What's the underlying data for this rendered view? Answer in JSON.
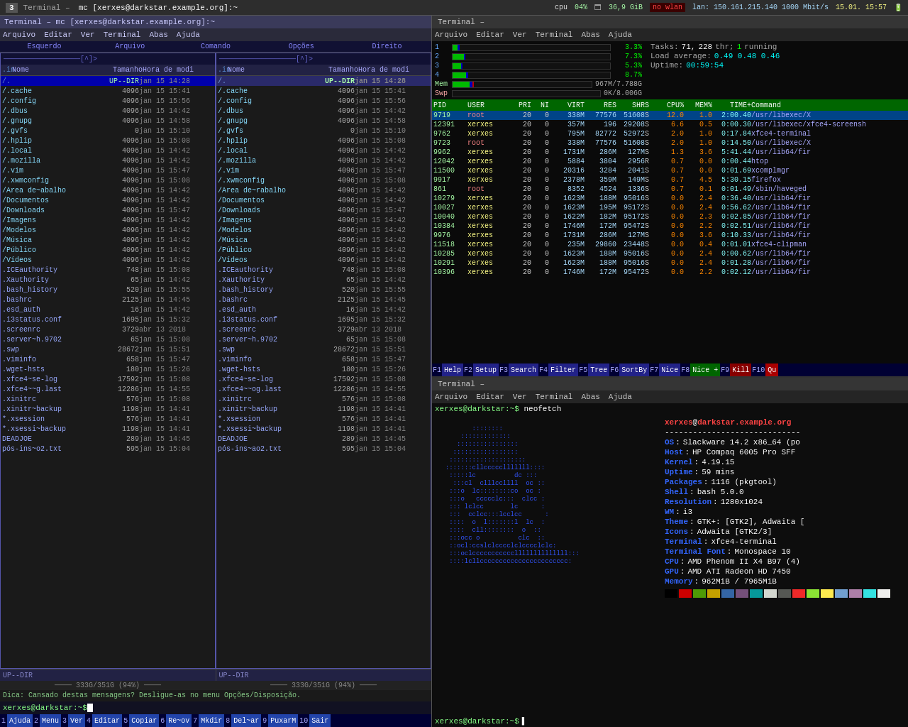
{
  "topbar": {
    "label": "Terminal –",
    "title": "mc [xerxes@darkstar.example.org]:~",
    "cpu_label": "cpu",
    "cpu_pct": "04%",
    "mem_icon": "🗖",
    "mem_val": "36,9 GiB",
    "net_warn": "no wlan",
    "net_label": "lan: 150.161.215.140  1000 Mbit/s",
    "time": "15.01. 15:57"
  },
  "left_panel": {
    "title": "Terminal – mc [xerxes@darkstar.example.org]:~",
    "menu_items": [
      "Arquivo",
      "Editar",
      "Ver",
      "Terminal",
      "Abas",
      "Ajuda"
    ],
    "panel_nav": "[^]>",
    "panel_labels": [
      "Esquerdo",
      "Arquivo",
      "Comando",
      "Opções",
      "Direito"
    ],
    "left_pane": {
      "header": "[^]>",
      "path": "~",
      "cols": [
        ".in",
        "Nome",
        "Tamanho",
        "Hora de modi"
      ],
      "selected_row": "/.",
      "selected_dir": "UP--DIR",
      "selected_date": "jan 15 14:28",
      "files": [
        {
          "name": "/.cache",
          "size": "4096",
          "date": "jan 15 15:41"
        },
        {
          "name": "/.config",
          "size": "4096",
          "date": "jan 15 15:56"
        },
        {
          "name": "/.dbus",
          "size": "4096",
          "date": "jan 15 14:42"
        },
        {
          "name": "/.gnupg",
          "size": "4096",
          "date": "jan 15 14:58"
        },
        {
          "name": "/.gvfs",
          "size": "0",
          "date": "jan 15 15:10"
        },
        {
          "name": "/.hplip",
          "size": "4096",
          "date": "jan 15 15:08"
        },
        {
          "name": "/.local",
          "size": "4096",
          "date": "jan 15 14:42"
        },
        {
          "name": "/.mozilla",
          "size": "4096",
          "date": "jan 15 14:42"
        },
        {
          "name": "/.vim",
          "size": "4096",
          "date": "jan 15 15:47"
        },
        {
          "name": "/.xwmconfig",
          "size": "4096",
          "date": "jan 15 15:08"
        },
        {
          "name": "/Área de~abalho",
          "size": "4096",
          "date": "jan 15 14:42"
        },
        {
          "name": "/Documentos",
          "size": "4096",
          "date": "jan 15 14:42"
        },
        {
          "name": "/Downloads",
          "size": "4096",
          "date": "jan 15 15:47"
        },
        {
          "name": "/Imagens",
          "size": "4096",
          "date": "jan 15 14:42"
        },
        {
          "name": "/Modelos",
          "size": "4096",
          "date": "jan 15 14:42"
        },
        {
          "name": "/Música",
          "size": "4096",
          "date": "jan 15 14:42"
        },
        {
          "name": "/Público",
          "size": "4096",
          "date": "jan 15 14:42"
        },
        {
          "name": "/Vídeos",
          "size": "4096",
          "date": "jan 15 14:42"
        },
        {
          "name": ".ICEauthority",
          "size": "748",
          "date": "jan 15 15:08"
        },
        {
          "name": ".Xauthority",
          "size": "65",
          "date": "jan 15 14:42"
        },
        {
          "name": ".bash_history",
          "size": "520",
          "date": "jan 15 15:55"
        },
        {
          "name": ".bashrc",
          "size": "2125",
          "date": "jan 15 14:45"
        },
        {
          "name": ".esd_auth",
          "size": "16",
          "date": "jan 15 14:42"
        },
        {
          "name": ".i3status.conf",
          "size": "1695",
          "date": "jan 15 15:32"
        },
        {
          "name": ".screenrc",
          "size": "3729",
          "date": "abr 13  2018"
        },
        {
          "name": ".server~h.9702",
          "size": "65",
          "date": "jan 15 15:08"
        },
        {
          "name": ".swp",
          "size": "28672",
          "date": "jan 15 15:51"
        },
        {
          "name": ".viminfo",
          "size": "658",
          "date": "jan 15 15:47"
        },
        {
          "name": ".wget-hsts",
          "size": "180",
          "date": "jan 15 15:26"
        },
        {
          "name": ".xfce4~se-log",
          "size": "17592",
          "date": "jan 15 15:08"
        },
        {
          "name": ".xfce4~~g.last",
          "size": "12286",
          "date": "jan 15 14:55"
        },
        {
          "name": ".xinitrc",
          "size": "576",
          "date": "jan 15 15:08"
        },
        {
          "name": ".xinitr~backup",
          "size": "1198",
          "date": "jan 15 14:41"
        },
        {
          "name": "*.xsession",
          "size": "576",
          "date": "jan 15 14:41"
        },
        {
          "name": "*.xsessi~backup",
          "size": "1198",
          "date": "jan 15 14:41"
        },
        {
          "name": "DEADJOE",
          "size": "289",
          "date": "jan 15 14:45"
        },
        {
          "name": "pós-ins~o2.txt",
          "size": "595",
          "date": "jan 15 15:04"
        }
      ]
    },
    "right_pane": {
      "header": "[^]>",
      "cols": [
        ".in",
        "Nome",
        "Tamanho",
        "Hora de modi"
      ],
      "selected_row": "/.",
      "selected_dir": "UP--DIR",
      "selected_date": "jan 15 14:28",
      "files": [
        {
          "name": "/.cache",
          "size": "4096",
          "date": "jan 15 15:41"
        },
        {
          "name": "/.config",
          "size": "4096",
          "date": "jan 15 15:56"
        },
        {
          "name": "/.dbus",
          "size": "4096",
          "date": "jan 15 14:42"
        },
        {
          "name": "/.gnupg",
          "size": "4096",
          "date": "jan 15 14:58"
        },
        {
          "name": "/.gvfs",
          "size": "0",
          "date": "jan 15 15:10"
        },
        {
          "name": "/.hplip",
          "size": "4096",
          "date": "jan 15 15:08"
        },
        {
          "name": "/.local",
          "size": "4096",
          "date": "jan 15 14:42"
        },
        {
          "name": "/.mozilla",
          "size": "4096",
          "date": "jan 15 14:42"
        },
        {
          "name": "/.vim",
          "size": "4096",
          "date": "jan 15 15:47"
        },
        {
          "name": "/.xwmconfig",
          "size": "4096",
          "date": "jan 15 15:08"
        },
        {
          "name": "/Área de~rabalho",
          "size": "4096",
          "date": "jan 15 14:42"
        },
        {
          "name": "/Documentos",
          "size": "4096",
          "date": "jan 15 14:42"
        },
        {
          "name": "/Downloads",
          "size": "4096",
          "date": "jan 15 15:47"
        },
        {
          "name": "/Imagens",
          "size": "4096",
          "date": "jan 15 14:42"
        },
        {
          "name": "/Modelos",
          "size": "4096",
          "date": "jan 15 14:42"
        },
        {
          "name": "/Música",
          "size": "4096",
          "date": "jan 15 14:42"
        },
        {
          "name": "/Público",
          "size": "4096",
          "date": "jan 15 14:42"
        },
        {
          "name": "/Vídeos",
          "size": "4096",
          "date": "jan 15 14:42"
        },
        {
          "name": ".ICEauthority",
          "size": "748",
          "date": "jan 15 15:08"
        },
        {
          "name": ".Xauthority",
          "size": "65",
          "date": "jan 15 14:42"
        },
        {
          "name": ".bash_history",
          "size": "520",
          "date": "jan 15 15:55"
        },
        {
          "name": ".bashrc",
          "size": "2125",
          "date": "jan 15 14:45"
        },
        {
          "name": ".esd_auth",
          "size": "16",
          "date": "jan 15 14:42"
        },
        {
          "name": ".i3status.conf",
          "size": "1695",
          "date": "jan 15 15:32"
        },
        {
          "name": ".screenrc",
          "size": "3729",
          "date": "abr 13  2018"
        },
        {
          "name": ".server~h.9702",
          "size": "65",
          "date": "jan 15 15:08"
        },
        {
          "name": ".swp",
          "size": "28672",
          "date": "jan 15 15:51"
        },
        {
          "name": ".viminfo",
          "size": "658",
          "date": "jan 15 15:47"
        },
        {
          "name": ".wget-hsts",
          "size": "180",
          "date": "jan 15 15:26"
        },
        {
          "name": ".xfce4~se-log",
          "size": "17592",
          "date": "jan 15 15:08"
        },
        {
          "name": ".xfce4~~og.last",
          "size": "12286",
          "date": "jan 15 14:55"
        },
        {
          "name": ".xinitrc",
          "size": "576",
          "date": "jan 15 15:08"
        },
        {
          "name": ".xinitr~backup",
          "size": "1198",
          "date": "jan 15 14:41"
        },
        {
          "name": "*.xsession",
          "size": "576",
          "date": "jan 15 14:41"
        },
        {
          "name": "*.xsessi~backup",
          "size": "1198",
          "date": "jan 15 14:41"
        },
        {
          "name": "DEADJOE",
          "size": "289",
          "date": "jan 15 14:45"
        },
        {
          "name": "pós-ins~ao2.txt",
          "size": "595",
          "date": "jan 15 15:04"
        }
      ]
    },
    "status_left": "UP--DIR",
    "status_right": "UP--DIR",
    "disk_left": "333G/351G (94%)",
    "disk_right": "333G/351G (94%)",
    "hint": "Dica: Cansado destas mensagens? Desligue-as no menu Opções/Disposição.",
    "cmdline_prompt": "xerxes@darkstar:~$",
    "funckeys": [
      {
        "num": "1",
        "label": "Ajuda"
      },
      {
        "num": "2",
        "label": "Menu"
      },
      {
        "num": "3",
        "label": "Ver"
      },
      {
        "num": "4",
        "label": "Editar"
      },
      {
        "num": "5",
        "label": "Copiar"
      },
      {
        "num": "6",
        "label": "Re~ov"
      },
      {
        "num": "7",
        "label": "Mkdir"
      },
      {
        "num": "8",
        "label": "Del~ar"
      },
      {
        "num": "9",
        "label": "PuxarM"
      },
      {
        "num": "10",
        "label": "Sair"
      }
    ]
  },
  "top_terminal": {
    "title": "Terminal –",
    "menu_items": [
      "Arquivo",
      "Editar",
      "Ver",
      "Terminal",
      "Abas",
      "Ajuda"
    ],
    "cpu_meters": [
      {
        "label": "1",
        "pct": 3.3,
        "text": "3.3%"
      },
      {
        "label": "2",
        "pct": 7.3,
        "text": "7.3%"
      },
      {
        "label": "3",
        "pct": 5.3,
        "text": "5.3%"
      },
      {
        "label": "4",
        "pct": 8.7,
        "text": "8.7%"
      }
    ],
    "mem_bar": {
      "used": 967,
      "total": 7788,
      "label": "Mem",
      "text": "967M/7.788G"
    },
    "swp_bar": {
      "used": 0,
      "total": 8006,
      "label": "Swp",
      "text": "0K/8.006G"
    },
    "tasks_label": "Tasks:",
    "tasks_count": "71,",
    "tasks_threads": "228",
    "tasks_thr_label": "thr:",
    "tasks_running": "1",
    "tasks_running_label": "running",
    "load_label": "Load average:",
    "load_val": "0.49  0.48  0.46",
    "uptime_label": "Uptime:",
    "uptime_val": "00:59:54",
    "col_headers": [
      "PID",
      "USER",
      "PRI",
      "NI",
      "VIRT",
      "RES",
      "SHR",
      "S",
      "CPU%",
      "MEM%",
      "TIME+",
      "Command"
    ],
    "processes": [
      {
        "pid": "9719",
        "user": "root",
        "pri": "20",
        "ni": "0",
        "virt": "338M",
        "res": "77576",
        "shr": "51608",
        "s": "S",
        "cpu": "12.0",
        "mem": "1.0",
        "time": "2:00.40",
        "cmd": "/usr/libexec/X"
      },
      {
        "pid": "12391",
        "user": "xerxes",
        "pri": "20",
        "ni": "0",
        "virt": "357M",
        "res": "196",
        "shr": "29208",
        "s": "S",
        "cpu": "6.6",
        "mem": "0.5",
        "time": "0:00.30",
        "cmd": "/usr/libexec/xfce4-screensh"
      },
      {
        "pid": "9762",
        "user": "xerxes",
        "pri": "20",
        "ni": "0",
        "virt": "795M",
        "res": "82772",
        "shr": "52972",
        "s": "S",
        "cpu": "2.0",
        "mem": "1.0",
        "time": "0:17.84",
        "cmd": "xfce4-terminal"
      },
      {
        "pid": "9723",
        "user": "root",
        "pri": "20",
        "ni": "0",
        "virt": "338M",
        "res": "77576",
        "shr": "51608",
        "s": "S",
        "cpu": "2.0",
        "mem": "1.0",
        "time": "0:14.50",
        "cmd": "/usr/libexec/X"
      },
      {
        "pid": "9962",
        "user": "xerxes",
        "pri": "20",
        "ni": "0",
        "virt": "1731M",
        "res": "286M",
        "shr": "127M",
        "s": "S",
        "cpu": "1.3",
        "mem": "3.6",
        "time": "5:41.44",
        "cmd": "/usr/lib64/fir"
      },
      {
        "pid": "12042",
        "user": "xerxes",
        "pri": "20",
        "ni": "0",
        "virt": "5884",
        "res": "3804",
        "shr": "2956",
        "s": "R",
        "cpu": "0.7",
        "mem": "0.0",
        "time": "0:00.44",
        "cmd": "htop"
      },
      {
        "pid": "11500",
        "user": "xerxes",
        "pri": "20",
        "ni": "0",
        "virt": "20316",
        "res": "3284",
        "shr": "2041",
        "s": "S",
        "cpu": "0.7",
        "mem": "0.0",
        "time": "0:01.69",
        "cmd": "xcomplmgr"
      },
      {
        "pid": "9917",
        "user": "xerxes",
        "pri": "20",
        "ni": "0",
        "virt": "2378M",
        "res": "359M",
        "shr": "149M",
        "s": "S",
        "cpu": "0.7",
        "mem": "4.5",
        "time": "5:30.15",
        "cmd": "firefox"
      },
      {
        "pid": "861",
        "user": "root",
        "pri": "20",
        "ni": "0",
        "virt": "8352",
        "res": "4524",
        "shr": "1336",
        "s": "S",
        "cpu": "0.7",
        "mem": "0.1",
        "time": "0:01.49",
        "cmd": "/sbin/haveged"
      },
      {
        "pid": "10279",
        "user": "xerxes",
        "pri": "20",
        "ni": "0",
        "virt": "1623M",
        "res": "188M",
        "shr": "95016",
        "s": "S",
        "cpu": "0.0",
        "mem": "2.4",
        "time": "0:36.40",
        "cmd": "/usr/lib64/fir"
      },
      {
        "pid": "10027",
        "user": "xerxes",
        "pri": "20",
        "ni": "0",
        "virt": "1623M",
        "res": "195M",
        "shr": "95172",
        "s": "S",
        "cpu": "0.0",
        "mem": "2.4",
        "time": "0:56.62",
        "cmd": "/usr/lib64/fir"
      },
      {
        "pid": "10040",
        "user": "xerxes",
        "pri": "20",
        "ni": "0",
        "virt": "1622M",
        "res": "182M",
        "shr": "95172",
        "s": "S",
        "cpu": "0.0",
        "mem": "2.3",
        "time": "0:02.85",
        "cmd": "/usr/lib64/fir"
      },
      {
        "pid": "10384",
        "user": "xerxes",
        "pri": "20",
        "ni": "0",
        "virt": "1746M",
        "res": "172M",
        "shr": "95472",
        "s": "S",
        "cpu": "0.0",
        "mem": "2.2",
        "time": "0:02.51",
        "cmd": "/usr/lib64/fir"
      },
      {
        "pid": "9976",
        "user": "xerxes",
        "pri": "20",
        "ni": "0",
        "virt": "1731M",
        "res": "286M",
        "shr": "127M",
        "s": "S",
        "cpu": "0.0",
        "mem": "3.6",
        "time": "0:10.33",
        "cmd": "/usr/lib64/fir"
      },
      {
        "pid": "11518",
        "user": "xerxes",
        "pri": "20",
        "ni": "0",
        "virt": "235M",
        "res": "29860",
        "shr": "23448",
        "s": "S",
        "cpu": "0.0",
        "mem": "0.4",
        "time": "0:01.01",
        "cmd": "xfce4-clipman"
      },
      {
        "pid": "10285",
        "user": "xerxes",
        "pri": "20",
        "ni": "0",
        "virt": "1623M",
        "res": "188M",
        "shr": "95016",
        "s": "S",
        "cpu": "0.0",
        "mem": "2.4",
        "time": "0:00.62",
        "cmd": "/usr/lib64/fir"
      },
      {
        "pid": "10291",
        "user": "xerxes",
        "pri": "20",
        "ni": "0",
        "virt": "1623M",
        "res": "188M",
        "shr": "95016",
        "s": "S",
        "cpu": "0.0",
        "mem": "2.4",
        "time": "0:01.28",
        "cmd": "/usr/lib64/fir"
      },
      {
        "pid": "10396",
        "user": "xerxes",
        "pri": "20",
        "ni": "0",
        "virt": "1746M",
        "res": "172M",
        "shr": "95472",
        "s": "S",
        "cpu": "0.0",
        "mem": "2.2",
        "time": "0:02.12",
        "cmd": "/usr/lib64/fir"
      }
    ],
    "funckeys": [
      {
        "num": "F1",
        "label": "Help"
      },
      {
        "num": "F2",
        "label": "Setup"
      },
      {
        "num": "F3",
        "label": "SearchF4"
      },
      {
        "num": "F4",
        "label": "Filter"
      },
      {
        "num": "F5",
        "label": "Tree"
      },
      {
        "num": "F6",
        "label": "SortBy"
      },
      {
        "num": "F7",
        "label": "Nice"
      },
      {
        "num": "F8",
        "label": "Nice +"
      },
      {
        "num": "F9",
        "label": "Kill"
      },
      {
        "num": "F10",
        "label": "Qu"
      }
    ]
  },
  "bottom_terminal": {
    "title": "Terminal –",
    "menu_items": [
      "Arquivo",
      "Editar",
      "Ver",
      "Terminal",
      "Abas",
      "Ajuda"
    ],
    "prompt": "xerxes@darkstar:~$ neofetch",
    "user_at_host": "xerxes@darkstar.example.org",
    "divider": "-----------------------------",
    "info": [
      {
        "key": "OS",
        "val": "Slackware 14.2 x86_64 (po"
      },
      {
        "key": "Host",
        "val": "HP Compaq 6005 Pro SFF"
      },
      {
        "key": "Kernel",
        "val": "4.19.15"
      },
      {
        "key": "Uptime",
        "val": "59 mins"
      },
      {
        "key": "Packages",
        "val": "1116 (pkgtool)"
      },
      {
        "key": "Shell",
        "val": "bash 5.0.0"
      },
      {
        "key": "Resolution",
        "val": "1280x1024"
      },
      {
        "key": "WM",
        "val": "i3"
      },
      {
        "key": "Theme",
        "val": "GTK+: [GTK2], Adwaita ["
      },
      {
        "key": "Icons",
        "val": "Adwaita [GTK2/3]"
      },
      {
        "key": "Terminal",
        "val": "xfce4-terminal"
      },
      {
        "key": "Terminal Font",
        "val": "Monospace 10"
      },
      {
        "key": "CPU",
        "val": "AMD Phenom II X4 B97 (4)"
      },
      {
        "key": "GPU",
        "val": "AMD ATI Radeon HD 7450"
      },
      {
        "key": "Memory",
        "val": "962MiB / 7965MiB"
      }
    ],
    "color_blocks": [
      "#000000",
      "#cc0000",
      "#4e9a06",
      "#c4a000",
      "#3465a4",
      "#75507b",
      "#06989a",
      "#d3d7cf",
      "#555753",
      "#ef2929",
      "#8ae234",
      "#fce94f",
      "#729fcf",
      "#ad7fa8",
      "#34e2e2",
      "#eeeeec"
    ],
    "end_prompt": "xerxes@darkstar:~$"
  }
}
